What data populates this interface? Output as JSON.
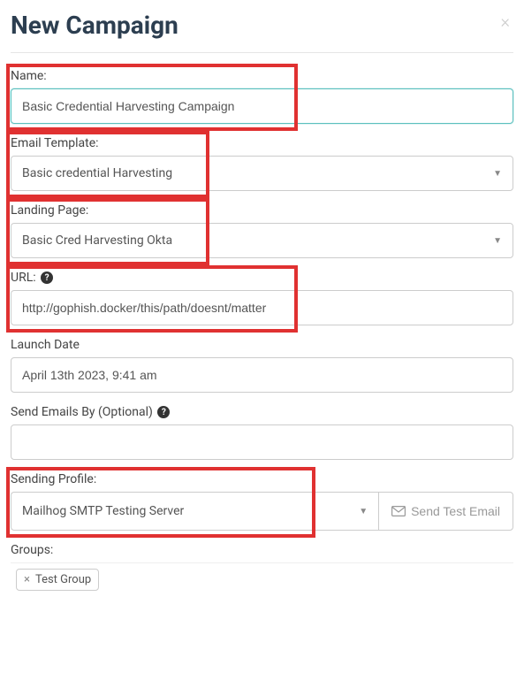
{
  "header": {
    "title": "New Campaign"
  },
  "fields": {
    "name": {
      "label": "Name:",
      "value": "Basic Credential Harvesting Campaign"
    },
    "emailTemplate": {
      "label": "Email Template:",
      "value": "Basic credential Harvesting"
    },
    "landingPage": {
      "label": "Landing Page:",
      "value": "Basic Cred Harvesting Okta"
    },
    "url": {
      "label": "URL:",
      "value": "http://gophish.docker/this/path/doesnt/matter"
    },
    "launchDate": {
      "label": "Launch Date",
      "value": "April 13th 2023, 9:41 am"
    },
    "sendBy": {
      "label": "Send Emails By (Optional)",
      "value": ""
    },
    "sendingProfile": {
      "label": "Sending Profile:",
      "value": "Mailhog SMTP Testing Server",
      "buttonLabel": "Send Test Email"
    },
    "groups": {
      "label": "Groups:",
      "tags": [
        "Test Group"
      ]
    }
  },
  "icons": {
    "help": "?"
  }
}
